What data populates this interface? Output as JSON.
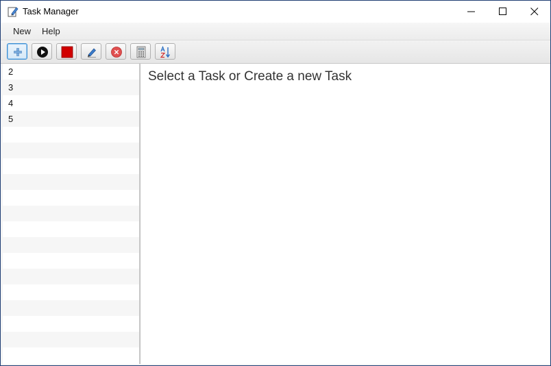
{
  "window": {
    "title": "Task Manager",
    "app_icon": "pencil-icon",
    "controls": [
      "minimize-icon",
      "maximize-icon",
      "close-icon"
    ]
  },
  "menubar": {
    "items": [
      {
        "label": "New"
      },
      {
        "label": "Help"
      }
    ]
  },
  "toolbar": {
    "buttons": [
      {
        "icon": "plus-icon",
        "state": "focused"
      },
      {
        "icon": "play-icon"
      },
      {
        "icon": "stop-icon"
      },
      {
        "icon": "edit-pencil-icon"
      },
      {
        "icon": "delete-icon"
      },
      {
        "icon": "calculator-icon"
      },
      {
        "icon": "sort-az-icon"
      }
    ]
  },
  "task_list": {
    "items": [
      "2",
      "3",
      "4",
      "5"
    ]
  },
  "main": {
    "prompt": "Select a Task or Create a new Task"
  },
  "colors": {
    "accent": "#3b8fd4",
    "stop_red": "#d10000",
    "delete_red": "#e05050",
    "list_alt_row": "#f6f6f6"
  }
}
